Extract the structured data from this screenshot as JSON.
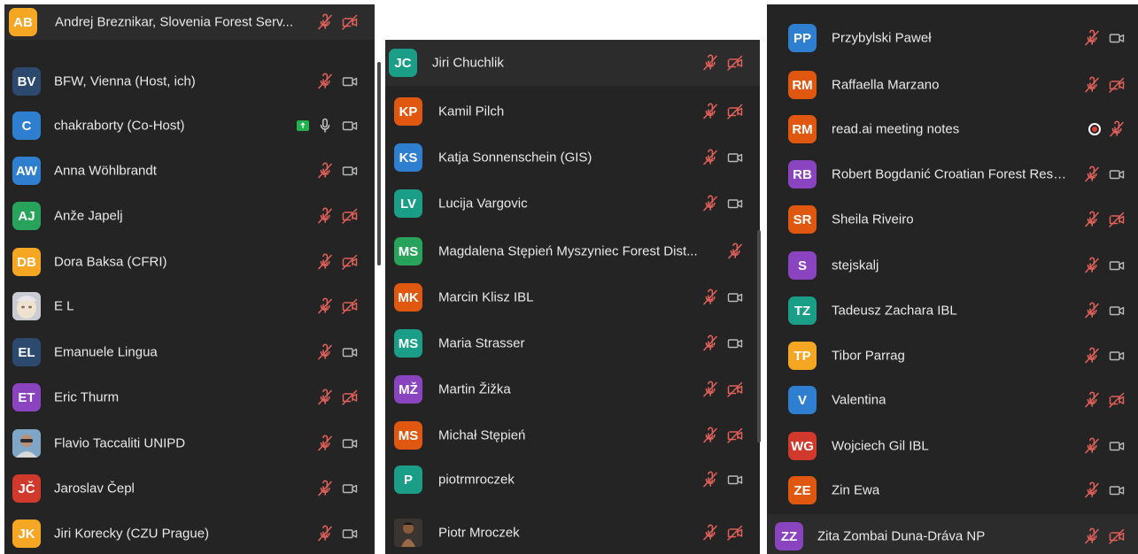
{
  "colors": {
    "panel_bg": "#242424",
    "muted_red": "#e0605a",
    "icon_gray": "#b8b8b8",
    "orange": "#f5a623",
    "navy": "#2c4a6e",
    "blue": "#2f7fd0",
    "green": "#27a35c",
    "teal": "#1a9e88",
    "red_orange": "#e0580f",
    "purple": "#8a44c0",
    "red": "#d0392b"
  },
  "columns": [
    {
      "participants": [
        {
          "initials": "AB",
          "name": "Andrej Breznikar, Slovenia Forest Serv...",
          "color": "orange",
          "mic": "muted",
          "video": "off"
        },
        {
          "initials": "BV",
          "name": "BFW, Vienna (Host, ich)",
          "color": "navy",
          "mic": "muted",
          "video": "on"
        },
        {
          "initials": "C",
          "name": "chakraborty (Co-Host)",
          "color": "blue",
          "mic": "on",
          "video": "on",
          "share": true
        },
        {
          "initials": "AW",
          "name": "Anna Wöhlbrandt",
          "color": "blue",
          "mic": "muted",
          "video": "on"
        },
        {
          "initials": "AJ",
          "name": "Anže Japelj",
          "color": "green",
          "mic": "muted",
          "video": "off"
        },
        {
          "initials": "DB",
          "name": "Dora Baksa (CFRI)",
          "color": "orange",
          "mic": "muted",
          "video": "off"
        },
        {
          "initials": "",
          "name": "E L",
          "color": "photo_baby",
          "mic": "muted",
          "video": "off",
          "photo": true
        },
        {
          "initials": "EL",
          "name": "Emanuele Lingua",
          "color": "navy",
          "mic": "muted",
          "video": "on"
        },
        {
          "initials": "ET",
          "name": "Eric Thurm",
          "color": "purple",
          "mic": "muted",
          "video": "off"
        },
        {
          "initials": "",
          "name": "Flavio Taccaliti UNIPD",
          "color": "photo_man",
          "mic": "muted",
          "video": "on",
          "photo": true
        },
        {
          "initials": "JČ",
          "name": "Jaroslav Čepl",
          "color": "red",
          "mic": "muted",
          "video": "on"
        },
        {
          "initials": "JK",
          "name": "Jiri Korecky (CZU Prague)",
          "color": "orange",
          "mic": "muted",
          "video": "on"
        }
      ]
    },
    {
      "participants": [
        {
          "initials": "JC",
          "name": "Jiri Chuchlik",
          "color": "teal",
          "mic": "muted",
          "video": "off"
        },
        {
          "initials": "KP",
          "name": "Kamil Pilch",
          "color": "red_orange",
          "mic": "muted",
          "video": "off"
        },
        {
          "initials": "KS",
          "name": "Katja Sonnenschein (GIS)",
          "color": "blue",
          "mic": "muted",
          "video": "on"
        },
        {
          "initials": "LV",
          "name": "Lucija Vargovic",
          "color": "teal",
          "mic": "muted",
          "video": "on"
        },
        {
          "initials": "MS",
          "name": "Magdalena Stępień Myszyniec Forest Dist...",
          "color": "green",
          "mic": "muted",
          "video": "none"
        },
        {
          "initials": "MK",
          "name": "Marcin Klisz IBL",
          "color": "red_orange",
          "mic": "muted",
          "video": "on"
        },
        {
          "initials": "MS",
          "name": "Maria Strasser",
          "color": "teal",
          "mic": "muted",
          "video": "on"
        },
        {
          "initials": "MŽ",
          "name": "Martin Žižka",
          "color": "purple",
          "mic": "muted",
          "video": "off"
        },
        {
          "initials": "MS",
          "name": "Michał Stępień",
          "color": "red_orange",
          "mic": "muted",
          "video": "off"
        },
        {
          "initials": "P",
          "name": "piotrmroczek",
          "color": "teal",
          "mic": "muted",
          "video": "on"
        },
        {
          "initials": "",
          "name": "Piotr Mroczek",
          "color": "photo_rambo",
          "mic": "muted",
          "video": "off",
          "photo": true
        }
      ]
    },
    {
      "participants": [
        {
          "initials": "PP",
          "name": "Przybylski Paweł",
          "color": "blue",
          "mic": "muted",
          "video": "on"
        },
        {
          "initials": "RM",
          "name": "Raffaella Marzano",
          "color": "red_orange",
          "mic": "muted",
          "video": "off"
        },
        {
          "initials": "RM",
          "name": "read.ai meeting notes",
          "color": "red_orange",
          "mic": "muted",
          "video": "none",
          "record": true
        },
        {
          "initials": "RB",
          "name": "Robert Bogdanić Croatian Forest Rese...",
          "color": "purple",
          "mic": "muted",
          "video": "on"
        },
        {
          "initials": "SR",
          "name": "Sheila Riveiro",
          "color": "red_orange",
          "mic": "muted",
          "video": "off"
        },
        {
          "initials": "S",
          "name": "stejskalj",
          "color": "purple",
          "mic": "muted",
          "video": "on"
        },
        {
          "initials": "TZ",
          "name": "Tadeusz Zachara IBL",
          "color": "teal",
          "mic": "muted",
          "video": "on"
        },
        {
          "initials": "TP",
          "name": "Tibor Parrag",
          "color": "orange",
          "mic": "muted",
          "video": "on"
        },
        {
          "initials": "V",
          "name": "Valentina",
          "color": "blue",
          "mic": "muted",
          "video": "off"
        },
        {
          "initials": "WG",
          "name": "Wojciech Gil IBL",
          "color": "red",
          "mic": "muted",
          "video": "on"
        },
        {
          "initials": "ZE",
          "name": "Zin Ewa",
          "color": "red_orange",
          "mic": "muted",
          "video": "on"
        },
        {
          "initials": "ZZ",
          "name": "Zita Zombai Duna-Dráva NP",
          "color": "purple",
          "mic": "muted",
          "video": "off"
        }
      ]
    }
  ]
}
